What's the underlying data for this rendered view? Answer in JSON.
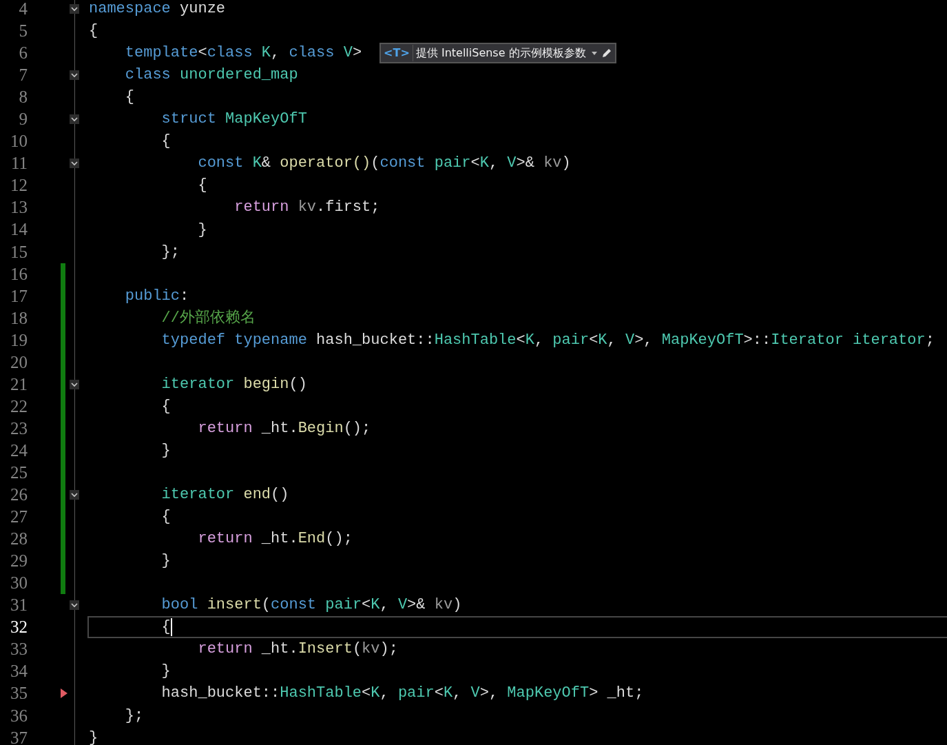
{
  "editor": {
    "lines": [
      {
        "number": "4",
        "fold": true,
        "changed": false,
        "selected": false,
        "marker": false,
        "code": [
          {
            "kind": "kw",
            "text": "namespace"
          },
          {
            "kind": "text",
            "text": " yunze"
          }
        ]
      },
      {
        "number": "5",
        "fold": false,
        "changed": false,
        "selected": false,
        "marker": false,
        "code": [
          {
            "kind": "text",
            "text": "{"
          }
        ]
      },
      {
        "number": "6",
        "fold": false,
        "changed": false,
        "selected": false,
        "marker": false,
        "code": [
          {
            "kind": "kw",
            "text": "    template"
          },
          {
            "kind": "text",
            "text": "<"
          },
          {
            "kind": "kw",
            "text": "class"
          },
          {
            "kind": "type",
            "text": " K"
          },
          {
            "kind": "text",
            "text": ", "
          },
          {
            "kind": "kw",
            "text": "class"
          },
          {
            "kind": "type",
            "text": " V"
          },
          {
            "kind": "text",
            "text": ">"
          }
        ],
        "hint": {
          "tag": "<T>",
          "text": "提供 IntelliSense 的示例模板参数"
        }
      },
      {
        "number": "7",
        "fold": true,
        "changed": false,
        "selected": false,
        "marker": false,
        "code": [
          {
            "kind": "kw",
            "text": "    class"
          },
          {
            "kind": "type",
            "text": " unordered_map"
          }
        ]
      },
      {
        "number": "8",
        "fold": false,
        "changed": false,
        "selected": false,
        "marker": false,
        "code": [
          {
            "kind": "text",
            "text": "    {"
          }
        ]
      },
      {
        "number": "9",
        "fold": true,
        "changed": false,
        "selected": false,
        "marker": false,
        "code": [
          {
            "kind": "kw",
            "text": "        struct"
          },
          {
            "kind": "type",
            "text": " MapKeyOfT"
          }
        ]
      },
      {
        "number": "10",
        "fold": false,
        "changed": false,
        "selected": false,
        "marker": false,
        "code": [
          {
            "kind": "text",
            "text": "        {"
          }
        ]
      },
      {
        "number": "11",
        "fold": true,
        "changed": false,
        "selected": false,
        "marker": false,
        "code": [
          {
            "kind": "kw",
            "text": "            const"
          },
          {
            "kind": "type",
            "text": " K"
          },
          {
            "kind": "text",
            "text": "& "
          },
          {
            "kind": "fn",
            "text": "operator()"
          },
          {
            "kind": "text",
            "text": "("
          },
          {
            "kind": "kw",
            "text": "const"
          },
          {
            "kind": "type",
            "text": " pair"
          },
          {
            "kind": "text",
            "text": "<"
          },
          {
            "kind": "type",
            "text": "K"
          },
          {
            "kind": "text",
            "text": ", "
          },
          {
            "kind": "type",
            "text": "V"
          },
          {
            "kind": "text",
            "text": ">& "
          },
          {
            "kind": "param",
            "text": "kv"
          },
          {
            "kind": "text",
            "text": ")"
          }
        ]
      },
      {
        "number": "12",
        "fold": false,
        "changed": false,
        "selected": false,
        "marker": false,
        "code": [
          {
            "kind": "text",
            "text": "            {"
          }
        ]
      },
      {
        "number": "13",
        "fold": false,
        "changed": false,
        "selected": false,
        "marker": false,
        "code": [
          {
            "kind": "ctrl",
            "text": "                return"
          },
          {
            "kind": "param",
            "text": " kv"
          },
          {
            "kind": "text",
            "text": ".first;"
          }
        ]
      },
      {
        "number": "14",
        "fold": false,
        "changed": false,
        "selected": false,
        "marker": false,
        "code": [
          {
            "kind": "text",
            "text": "            }"
          }
        ]
      },
      {
        "number": "15",
        "fold": false,
        "changed": false,
        "selected": false,
        "marker": false,
        "code": [
          {
            "kind": "text",
            "text": "        };"
          }
        ]
      },
      {
        "number": "16",
        "fold": false,
        "changed": true,
        "selected": false,
        "marker": false
      },
      {
        "number": "17",
        "fold": false,
        "changed": true,
        "selected": false,
        "marker": false,
        "code": [
          {
            "kind": "kw",
            "text": "    public"
          },
          {
            "kind": "text",
            "text": ":"
          }
        ]
      },
      {
        "number": "18",
        "fold": false,
        "changed": true,
        "selected": false,
        "marker": false,
        "code": [
          {
            "kind": "comment",
            "text": "        //外部依赖名"
          }
        ]
      },
      {
        "number": "19",
        "fold": false,
        "changed": true,
        "selected": false,
        "marker": false,
        "code": [
          {
            "kind": "kw",
            "text": "        typedef typename"
          },
          {
            "kind": "text",
            "text": " hash_bucket::"
          },
          {
            "kind": "type",
            "text": "HashTable"
          },
          {
            "kind": "text",
            "text": "<"
          },
          {
            "kind": "type",
            "text": "K"
          },
          {
            "kind": "text",
            "text": ", "
          },
          {
            "kind": "type",
            "text": "pair"
          },
          {
            "kind": "text",
            "text": "<"
          },
          {
            "kind": "type",
            "text": "K"
          },
          {
            "kind": "text",
            "text": ", "
          },
          {
            "kind": "type",
            "text": "V"
          },
          {
            "kind": "text",
            "text": ">, "
          },
          {
            "kind": "type",
            "text": "MapKeyOfT"
          },
          {
            "kind": "text",
            "text": ">::"
          },
          {
            "kind": "type",
            "text": "Iterator iterator"
          },
          {
            "kind": "text",
            "text": ";"
          }
        ]
      },
      {
        "number": "20",
        "fold": false,
        "changed": true,
        "selected": false,
        "marker": false
      },
      {
        "number": "21",
        "fold": true,
        "changed": true,
        "selected": false,
        "marker": false,
        "code": [
          {
            "kind": "type",
            "text": "        iterator"
          },
          {
            "kind": "fn",
            "text": " begin"
          },
          {
            "kind": "text",
            "text": "()"
          }
        ]
      },
      {
        "number": "22",
        "fold": false,
        "changed": true,
        "selected": false,
        "marker": false,
        "code": [
          {
            "kind": "text",
            "text": "        {"
          }
        ]
      },
      {
        "number": "23",
        "fold": false,
        "changed": true,
        "selected": false,
        "marker": false,
        "code": [
          {
            "kind": "ctrl",
            "text": "            return"
          },
          {
            "kind": "text",
            "text": " _ht."
          },
          {
            "kind": "fn",
            "text": "Begin"
          },
          {
            "kind": "text",
            "text": "();"
          }
        ]
      },
      {
        "number": "24",
        "fold": false,
        "changed": true,
        "selected": false,
        "marker": false,
        "code": [
          {
            "kind": "text",
            "text": "        }"
          }
        ]
      },
      {
        "number": "25",
        "fold": false,
        "changed": true,
        "selected": false,
        "marker": false
      },
      {
        "number": "26",
        "fold": true,
        "changed": true,
        "selected": false,
        "marker": false,
        "code": [
          {
            "kind": "type",
            "text": "        iterator"
          },
          {
            "kind": "fn",
            "text": " end"
          },
          {
            "kind": "text",
            "text": "()"
          }
        ]
      },
      {
        "number": "27",
        "fold": false,
        "changed": true,
        "selected": false,
        "marker": false,
        "code": [
          {
            "kind": "text",
            "text": "        {"
          }
        ]
      },
      {
        "number": "28",
        "fold": false,
        "changed": true,
        "selected": false,
        "marker": false,
        "code": [
          {
            "kind": "ctrl",
            "text": "            return"
          },
          {
            "kind": "text",
            "text": " _ht."
          },
          {
            "kind": "fn",
            "text": "End"
          },
          {
            "kind": "text",
            "text": "();"
          }
        ]
      },
      {
        "number": "29",
        "fold": false,
        "changed": true,
        "selected": false,
        "marker": false,
        "code": [
          {
            "kind": "text",
            "text": "        }"
          }
        ]
      },
      {
        "number": "30",
        "fold": false,
        "changed": true,
        "selected": false,
        "marker": false
      },
      {
        "number": "31",
        "fold": true,
        "changed": false,
        "selected": false,
        "marker": false,
        "code": [
          {
            "kind": "kw",
            "text": "        bool"
          },
          {
            "kind": "fn",
            "text": " insert"
          },
          {
            "kind": "text",
            "text": "("
          },
          {
            "kind": "kw",
            "text": "const"
          },
          {
            "kind": "type",
            "text": " pair"
          },
          {
            "kind": "text",
            "text": "<"
          },
          {
            "kind": "type",
            "text": "K"
          },
          {
            "kind": "text",
            "text": ", "
          },
          {
            "kind": "type",
            "text": "V"
          },
          {
            "kind": "text",
            "text": ">& "
          },
          {
            "kind": "param",
            "text": "kv"
          },
          {
            "kind": "text",
            "text": ")"
          }
        ]
      },
      {
        "number": "32",
        "fold": false,
        "changed": false,
        "selected": true,
        "marker": false,
        "code": [
          {
            "kind": "text",
            "text": "        {"
          }
        ]
      },
      {
        "number": "33",
        "fold": false,
        "changed": false,
        "selected": false,
        "marker": false,
        "code": [
          {
            "kind": "ctrl",
            "text": "            return"
          },
          {
            "kind": "text",
            "text": " _ht."
          },
          {
            "kind": "fn",
            "text": "Insert"
          },
          {
            "kind": "text",
            "text": "("
          },
          {
            "kind": "param",
            "text": "kv"
          },
          {
            "kind": "text",
            "text": ");"
          }
        ]
      },
      {
        "number": "34",
        "fold": false,
        "changed": false,
        "selected": false,
        "marker": false,
        "code": [
          {
            "kind": "text",
            "text": "        }"
          }
        ]
      },
      {
        "number": "35",
        "fold": false,
        "changed": false,
        "selected": false,
        "marker": true,
        "code": [
          {
            "kind": "text",
            "text": "        hash_bucket::"
          },
          {
            "kind": "type",
            "text": "HashTable"
          },
          {
            "kind": "text",
            "text": "<"
          },
          {
            "kind": "type",
            "text": "K"
          },
          {
            "kind": "text",
            "text": ", "
          },
          {
            "kind": "type",
            "text": "pair"
          },
          {
            "kind": "text",
            "text": "<"
          },
          {
            "kind": "type",
            "text": "K"
          },
          {
            "kind": "text",
            "text": ", "
          },
          {
            "kind": "type",
            "text": "V"
          },
          {
            "kind": "text",
            "text": ">, "
          },
          {
            "kind": "type",
            "text": "MapKeyOfT"
          },
          {
            "kind": "text",
            "text": "> _ht;"
          }
        ]
      },
      {
        "number": "36",
        "fold": false,
        "changed": false,
        "selected": false,
        "marker": false,
        "code": [
          {
            "kind": "text",
            "text": "    };"
          }
        ]
      },
      {
        "number": "37",
        "fold": false,
        "changed": false,
        "selected": false,
        "marker": false,
        "code": [
          {
            "kind": "text",
            "text": "}"
          }
        ]
      }
    ]
  }
}
